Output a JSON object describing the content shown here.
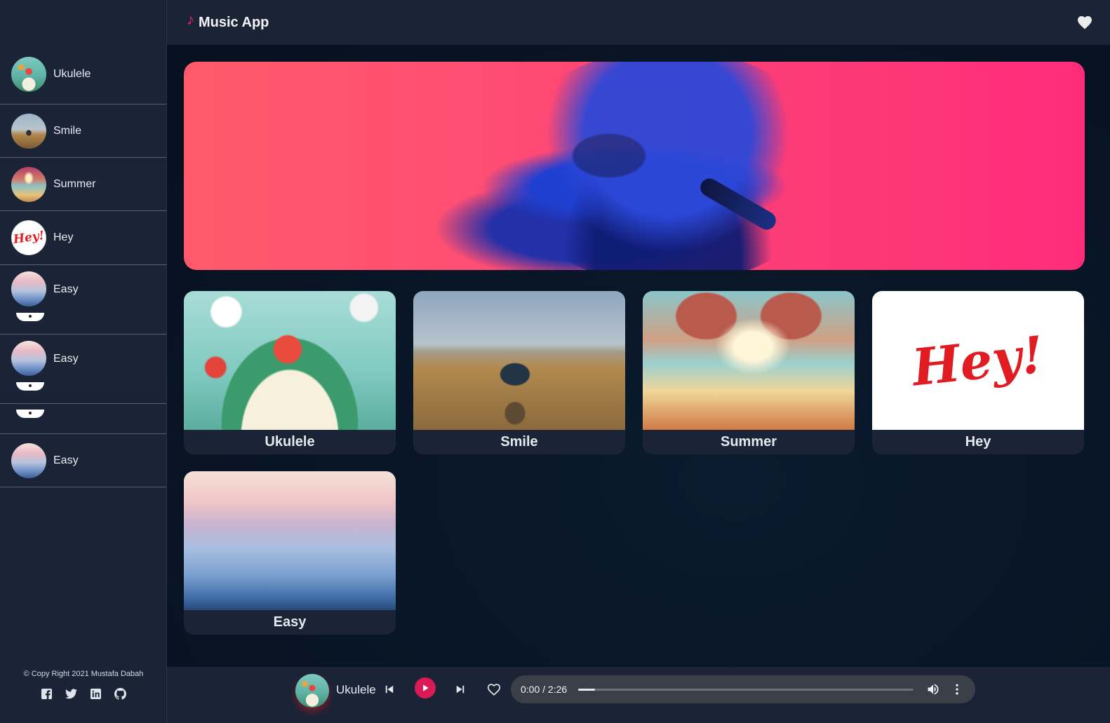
{
  "header": {
    "title": "Music App",
    "logo_icon": "music-note-icon",
    "favorites_icon": "heart-icon"
  },
  "sidebar": {
    "items": [
      {
        "label": "Ukulele"
      },
      {
        "label": "Smile"
      },
      {
        "label": "Summer"
      },
      {
        "label": "Hey"
      },
      {
        "label": "Easy"
      },
      {
        "label": "Easy"
      },
      {
        "label": "Easy"
      }
    ],
    "footer": {
      "copyright": "© Copy Right 2021 Mustafa Dabah",
      "socials": [
        "facebook-icon",
        "twitter-icon",
        "linkedin-icon",
        "github-icon"
      ]
    }
  },
  "main": {
    "songs": [
      {
        "title": "Ukulele"
      },
      {
        "title": "Smile"
      },
      {
        "title": "Summer"
      },
      {
        "title": "Hey"
      },
      {
        "title": "Easy"
      }
    ],
    "hey_art_text": "Hey!"
  },
  "player": {
    "current_title": "Ukulele",
    "time": "0:00 / 2:26",
    "progress": 0.05,
    "colors": {
      "accent": "#d81a55",
      "brand_note": "#e5245f"
    }
  }
}
